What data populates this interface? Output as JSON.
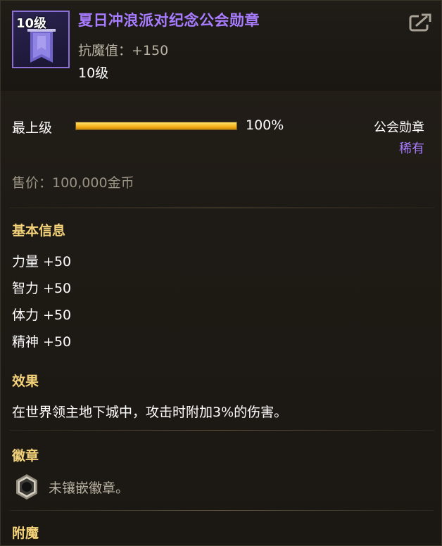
{
  "header": {
    "icon_level": "10级",
    "title": "夏日冲浪派对纪念公会勋章",
    "stat": "抗魔值：+150",
    "level": "10级"
  },
  "level_row": {
    "label": "最上级",
    "progress_percent": 100,
    "progress_text": "100%",
    "type": "公会勋章",
    "rarity": "稀有"
  },
  "price": "售价：100,000金币",
  "basic_info": {
    "title": "基本信息",
    "stats": [
      "力量 +50",
      "智力 +50",
      "体力 +50",
      "精神 +50"
    ]
  },
  "effect": {
    "title": "效果",
    "text": "在世界领主地下城中，攻击时附加3%的伤害。"
  },
  "emblem": {
    "title": "徽章",
    "text": "未镶嵌徽章。",
    "icon": "empty-emblem-slot-icon"
  },
  "enchant": {
    "title": "附魔"
  },
  "colors": {
    "title_purple": "#a77cff",
    "section_gold": "#f3d27a",
    "progress_gold": "#f5b01a"
  },
  "icons": {
    "share": "share-export-icon",
    "item": "guild-banner-icon"
  }
}
